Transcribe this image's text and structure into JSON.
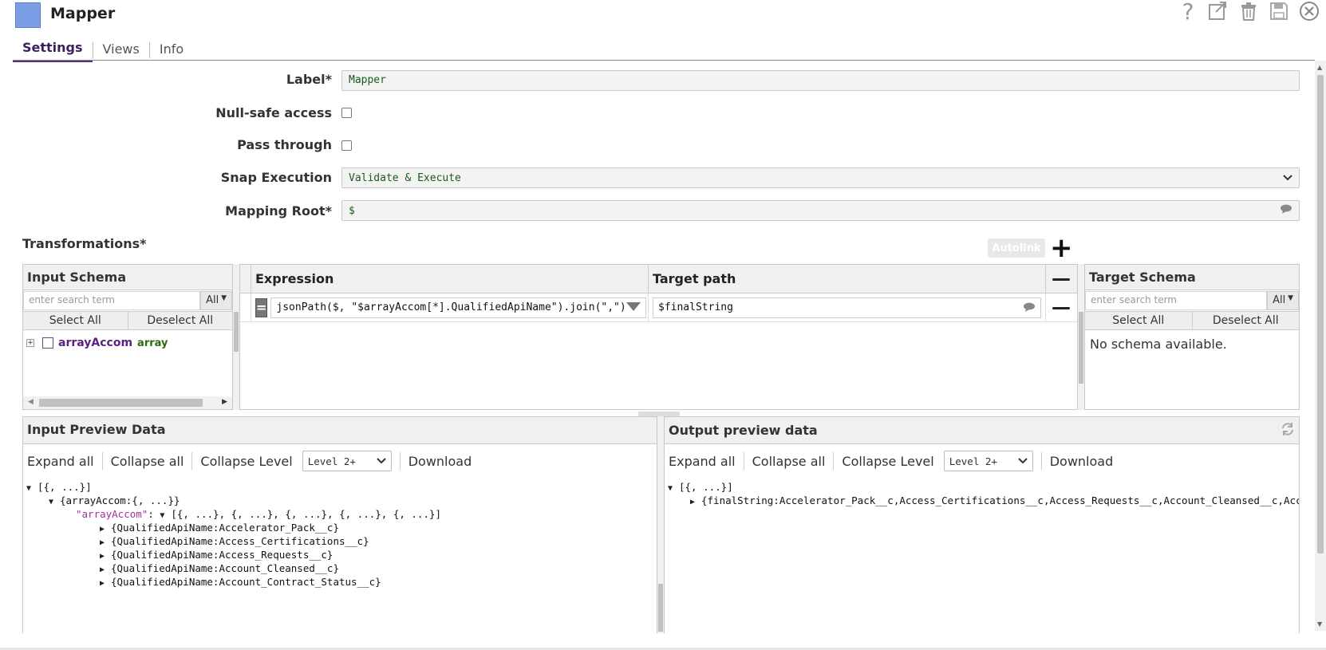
{
  "header": {
    "title": "Mapper",
    "icons": [
      "help-icon",
      "export-icon",
      "trash-icon",
      "save-icon",
      "close-icon"
    ]
  },
  "tabs": [
    {
      "label": "Settings",
      "active": true
    },
    {
      "label": "Views",
      "active": false
    },
    {
      "label": "Info",
      "active": false
    }
  ],
  "form": {
    "label_label": "Label*",
    "label_value": "Mapper",
    "nullsafe_label": "Null-safe access",
    "passthrough_label": "Pass through",
    "snapexec_label": "Snap Execution",
    "snapexec_value": "Validate & Execute",
    "mappingroot_label": "Mapping Root*",
    "mappingroot_value": "$"
  },
  "transformations": {
    "title": "Transformations*",
    "autolink_label": "Autolink",
    "plus": "+",
    "minus": "—"
  },
  "input_schema": {
    "title": "Input Schema",
    "search_placeholder": "enter search term",
    "all_label": "All",
    "select_all": "Select All",
    "deselect_all": "Deselect All",
    "tree_name": "arrayAccom",
    "tree_type": "array"
  },
  "mapping": {
    "expression_header": "Expression",
    "target_header": "Target path",
    "eq_label": "=",
    "expression_value": "jsonPath($, \"$arrayAccom[*].QualifiedApiName\").join(\",\")",
    "target_value": "$finalString"
  },
  "target_schema": {
    "title": "Target Schema",
    "search_placeholder": "enter search term",
    "all_label": "All",
    "select_all": "Select All",
    "deselect_all": "Deselect All",
    "empty_text": "No schema available."
  },
  "input_preview": {
    "title": "Input Preview Data",
    "expand_all": "Expand all",
    "collapse_all": "Collapse all",
    "collapse_level": "Collapse Level",
    "level_value": "Level 2+",
    "download": "Download",
    "tree": {
      "root": "[{, ...}]",
      "obj": "{arrayAccom:{, ...}}",
      "key": "\"arrayAccom\"",
      "colon": ":",
      "arr": "[{, ...}, {, ...}, {, ...}, {, ...}, {, ...}]",
      "items": [
        "{QualifiedApiName:Accelerator_Pack__c}",
        "{QualifiedApiName:Access_Certifications__c}",
        "{QualifiedApiName:Access_Requests__c}",
        "{QualifiedApiName:Account_Cleansed__c}",
        "{QualifiedApiName:Account_Contract_Status__c}"
      ]
    }
  },
  "output_preview": {
    "title": "Output preview data",
    "expand_all": "Expand all",
    "collapse_all": "Collapse all",
    "collapse_level": "Collapse Level",
    "level_value": "Level 2+",
    "download": "Download",
    "tree": {
      "root": "[{, ...}]",
      "item": "{finalString:Accelerator_Pack__c,Access_Certifications__c,Access_Requests__c,Account_Cleansed__c,Acco"
    }
  }
}
